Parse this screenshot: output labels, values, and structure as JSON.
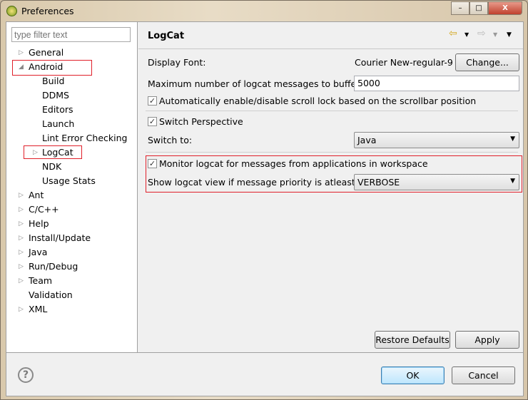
{
  "window": {
    "title": "Preferences",
    "minimize": "–",
    "maximize": "□",
    "close": "X"
  },
  "filter": {
    "placeholder": "type filter text"
  },
  "tree": [
    {
      "label": "General",
      "expander": "▷"
    },
    {
      "label": "Android",
      "expander": "◢"
    },
    {
      "label": "Build"
    },
    {
      "label": "DDMS"
    },
    {
      "label": "Editors"
    },
    {
      "label": "Launch"
    },
    {
      "label": "Lint Error Checking"
    },
    {
      "label": "LogCat",
      "expander": "▷"
    },
    {
      "label": "NDK"
    },
    {
      "label": "Usage Stats"
    },
    {
      "label": "Ant",
      "expander": "▷"
    },
    {
      "label": "C/C++",
      "expander": "▷"
    },
    {
      "label": "Help",
      "expander": "▷"
    },
    {
      "label": "Install/Update",
      "expander": "▷"
    },
    {
      "label": "Java",
      "expander": "▷"
    },
    {
      "label": "Run/Debug",
      "expander": "▷"
    },
    {
      "label": "Team",
      "expander": "▷"
    },
    {
      "label": "Validation"
    },
    {
      "label": "XML",
      "expander": "▷"
    }
  ],
  "page": {
    "title": "LogCat",
    "nav": {
      "back": "⇦",
      "back_menu": "▼",
      "forward": "⇨",
      "forward_menu": "▼",
      "menu": "▼"
    },
    "display_font_label": "Display Font:",
    "display_font_value": "Courier New-regular-9",
    "change_button": "Change...",
    "max_messages_label": "Maximum number of logcat messages to buffer:",
    "max_messages_value": "5000",
    "auto_scroll_lock": {
      "label": "Automatically enable/disable scroll lock based on the scrollbar position",
      "checked": true
    },
    "switch_perspective": {
      "label": "Switch Perspective",
      "checked": true
    },
    "switch_to_label": "Switch to:",
    "switch_to_value": "Java",
    "monitor": {
      "label": "Monitor logcat for messages from applications in workspace",
      "checked": true
    },
    "priority_label": "Show logcat view if message priority is atleast:",
    "priority_value": "VERBOSE",
    "restore_defaults": "Restore Defaults",
    "apply": "Apply",
    "check": "✓",
    "dropdown_arrow": "▼"
  },
  "footer": {
    "help": "?",
    "ok": "OK",
    "cancel": "Cancel"
  },
  "colors": {
    "highlight_box": "#e0202a"
  }
}
